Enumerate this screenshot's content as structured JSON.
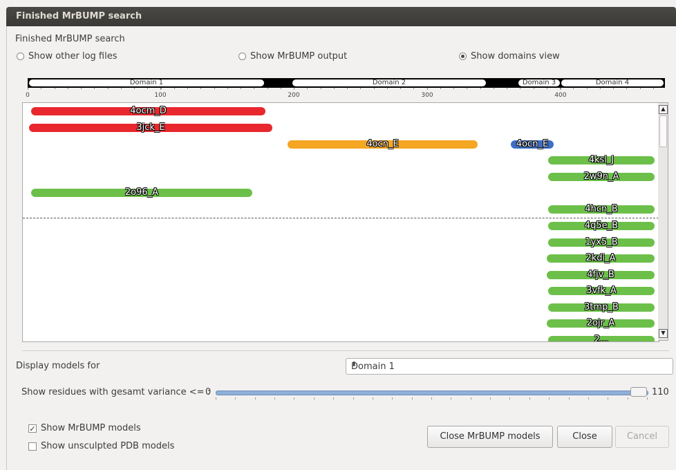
{
  "window": {
    "title": "Finished MrBUMP search"
  },
  "section_title": "Finished MrBUMP search",
  "view_options": [
    {
      "label": "Show other log files",
      "checked": false
    },
    {
      "label": "Show MrBUMP output",
      "checked": false
    },
    {
      "label": "Show domains view",
      "checked": true
    }
  ],
  "domains": [
    "Domain 1",
    "Domain 2",
    "Domain 3",
    "Domain 4"
  ],
  "ruler_labels": [
    "0",
    "100",
    "200",
    "300",
    "400"
  ],
  "models": [
    {
      "name": "4ocm_D",
      "color": "#e8282e"
    },
    {
      "name": "3jck_E",
      "color": "#e8282e"
    },
    {
      "name": "4ocn_E",
      "color": "#f5a623"
    },
    {
      "name": "4ocn_E",
      "color": "#3d6ec9"
    },
    {
      "name": "4ksl_J",
      "color": "#6cc04a"
    },
    {
      "name": "2w9n_A",
      "color": "#6cc04a"
    },
    {
      "name": "2o96_A",
      "color": "#6cc04a"
    },
    {
      "name": "4hcn_B",
      "color": "#6cc04a"
    },
    {
      "name": "4q5e_B",
      "color": "#6cc04a"
    },
    {
      "name": "1yx5_B",
      "color": "#6cc04a"
    },
    {
      "name": "2kdi_A",
      "color": "#6cc04a"
    },
    {
      "name": "4fjv_B",
      "color": "#6cc04a"
    },
    {
      "name": "3vfk_A",
      "color": "#6cc04a"
    },
    {
      "name": "3tmp_B",
      "color": "#6cc04a"
    },
    {
      "name": "2ojr_A",
      "color": "#6cc04a"
    },
    {
      "name": "2...",
      "color": "#6cc04a"
    }
  ],
  "display_models": {
    "label": "Display models for",
    "selected": "Domain 1"
  },
  "variance": {
    "label": "Show residues with gesamt variance <= :",
    "min": "0",
    "max": "110",
    "value": 110
  },
  "checkboxes": [
    {
      "label": "Show MrBUMP models",
      "checked": true
    },
    {
      "label": "Show unsculpted PDB models",
      "checked": false
    }
  ],
  "buttons": {
    "close_models": "Close MrBUMP models",
    "close": "Close",
    "cancel": "Cancel"
  }
}
